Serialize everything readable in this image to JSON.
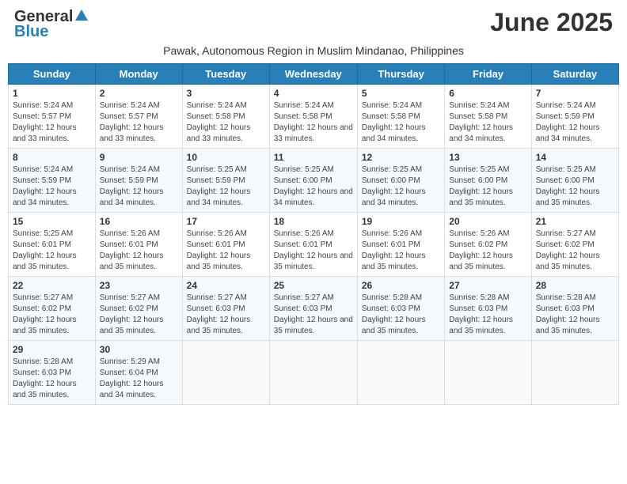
{
  "header": {
    "logo_general": "General",
    "logo_blue": "Blue",
    "month_title": "June 2025",
    "subtitle": "Pawak, Autonomous Region in Muslim Mindanao, Philippines"
  },
  "weekdays": [
    "Sunday",
    "Monday",
    "Tuesday",
    "Wednesday",
    "Thursday",
    "Friday",
    "Saturday"
  ],
  "weeks": [
    [
      {
        "day": "1",
        "sunrise": "5:24 AM",
        "sunset": "5:57 PM",
        "daylight": "12 hours and 33 minutes."
      },
      {
        "day": "2",
        "sunrise": "5:24 AM",
        "sunset": "5:57 PM",
        "daylight": "12 hours and 33 minutes."
      },
      {
        "day": "3",
        "sunrise": "5:24 AM",
        "sunset": "5:58 PM",
        "daylight": "12 hours and 33 minutes."
      },
      {
        "day": "4",
        "sunrise": "5:24 AM",
        "sunset": "5:58 PM",
        "daylight": "12 hours and 33 minutes."
      },
      {
        "day": "5",
        "sunrise": "5:24 AM",
        "sunset": "5:58 PM",
        "daylight": "12 hours and 34 minutes."
      },
      {
        "day": "6",
        "sunrise": "5:24 AM",
        "sunset": "5:58 PM",
        "daylight": "12 hours and 34 minutes."
      },
      {
        "day": "7",
        "sunrise": "5:24 AM",
        "sunset": "5:59 PM",
        "daylight": "12 hours and 34 minutes."
      }
    ],
    [
      {
        "day": "8",
        "sunrise": "5:24 AM",
        "sunset": "5:59 PM",
        "daylight": "12 hours and 34 minutes."
      },
      {
        "day": "9",
        "sunrise": "5:24 AM",
        "sunset": "5:59 PM",
        "daylight": "12 hours and 34 minutes."
      },
      {
        "day": "10",
        "sunrise": "5:25 AM",
        "sunset": "5:59 PM",
        "daylight": "12 hours and 34 minutes."
      },
      {
        "day": "11",
        "sunrise": "5:25 AM",
        "sunset": "6:00 PM",
        "daylight": "12 hours and 34 minutes."
      },
      {
        "day": "12",
        "sunrise": "5:25 AM",
        "sunset": "6:00 PM",
        "daylight": "12 hours and 34 minutes."
      },
      {
        "day": "13",
        "sunrise": "5:25 AM",
        "sunset": "6:00 PM",
        "daylight": "12 hours and 35 minutes."
      },
      {
        "day": "14",
        "sunrise": "5:25 AM",
        "sunset": "6:00 PM",
        "daylight": "12 hours and 35 minutes."
      }
    ],
    [
      {
        "day": "15",
        "sunrise": "5:25 AM",
        "sunset": "6:01 PM",
        "daylight": "12 hours and 35 minutes."
      },
      {
        "day": "16",
        "sunrise": "5:26 AM",
        "sunset": "6:01 PM",
        "daylight": "12 hours and 35 minutes."
      },
      {
        "day": "17",
        "sunrise": "5:26 AM",
        "sunset": "6:01 PM",
        "daylight": "12 hours and 35 minutes."
      },
      {
        "day": "18",
        "sunrise": "5:26 AM",
        "sunset": "6:01 PM",
        "daylight": "12 hours and 35 minutes."
      },
      {
        "day": "19",
        "sunrise": "5:26 AM",
        "sunset": "6:01 PM",
        "daylight": "12 hours and 35 minutes."
      },
      {
        "day": "20",
        "sunrise": "5:26 AM",
        "sunset": "6:02 PM",
        "daylight": "12 hours and 35 minutes."
      },
      {
        "day": "21",
        "sunrise": "5:27 AM",
        "sunset": "6:02 PM",
        "daylight": "12 hours and 35 minutes."
      }
    ],
    [
      {
        "day": "22",
        "sunrise": "5:27 AM",
        "sunset": "6:02 PM",
        "daylight": "12 hours and 35 minutes."
      },
      {
        "day": "23",
        "sunrise": "5:27 AM",
        "sunset": "6:02 PM",
        "daylight": "12 hours and 35 minutes."
      },
      {
        "day": "24",
        "sunrise": "5:27 AM",
        "sunset": "6:03 PM",
        "daylight": "12 hours and 35 minutes."
      },
      {
        "day": "25",
        "sunrise": "5:27 AM",
        "sunset": "6:03 PM",
        "daylight": "12 hours and 35 minutes."
      },
      {
        "day": "26",
        "sunrise": "5:28 AM",
        "sunset": "6:03 PM",
        "daylight": "12 hours and 35 minutes."
      },
      {
        "day": "27",
        "sunrise": "5:28 AM",
        "sunset": "6:03 PM",
        "daylight": "12 hours and 35 minutes."
      },
      {
        "day": "28",
        "sunrise": "5:28 AM",
        "sunset": "6:03 PM",
        "daylight": "12 hours and 35 minutes."
      }
    ],
    [
      {
        "day": "29",
        "sunrise": "5:28 AM",
        "sunset": "6:03 PM",
        "daylight": "12 hours and 35 minutes."
      },
      {
        "day": "30",
        "sunrise": "5:29 AM",
        "sunset": "6:04 PM",
        "daylight": "12 hours and 34 minutes."
      },
      null,
      null,
      null,
      null,
      null
    ]
  ]
}
